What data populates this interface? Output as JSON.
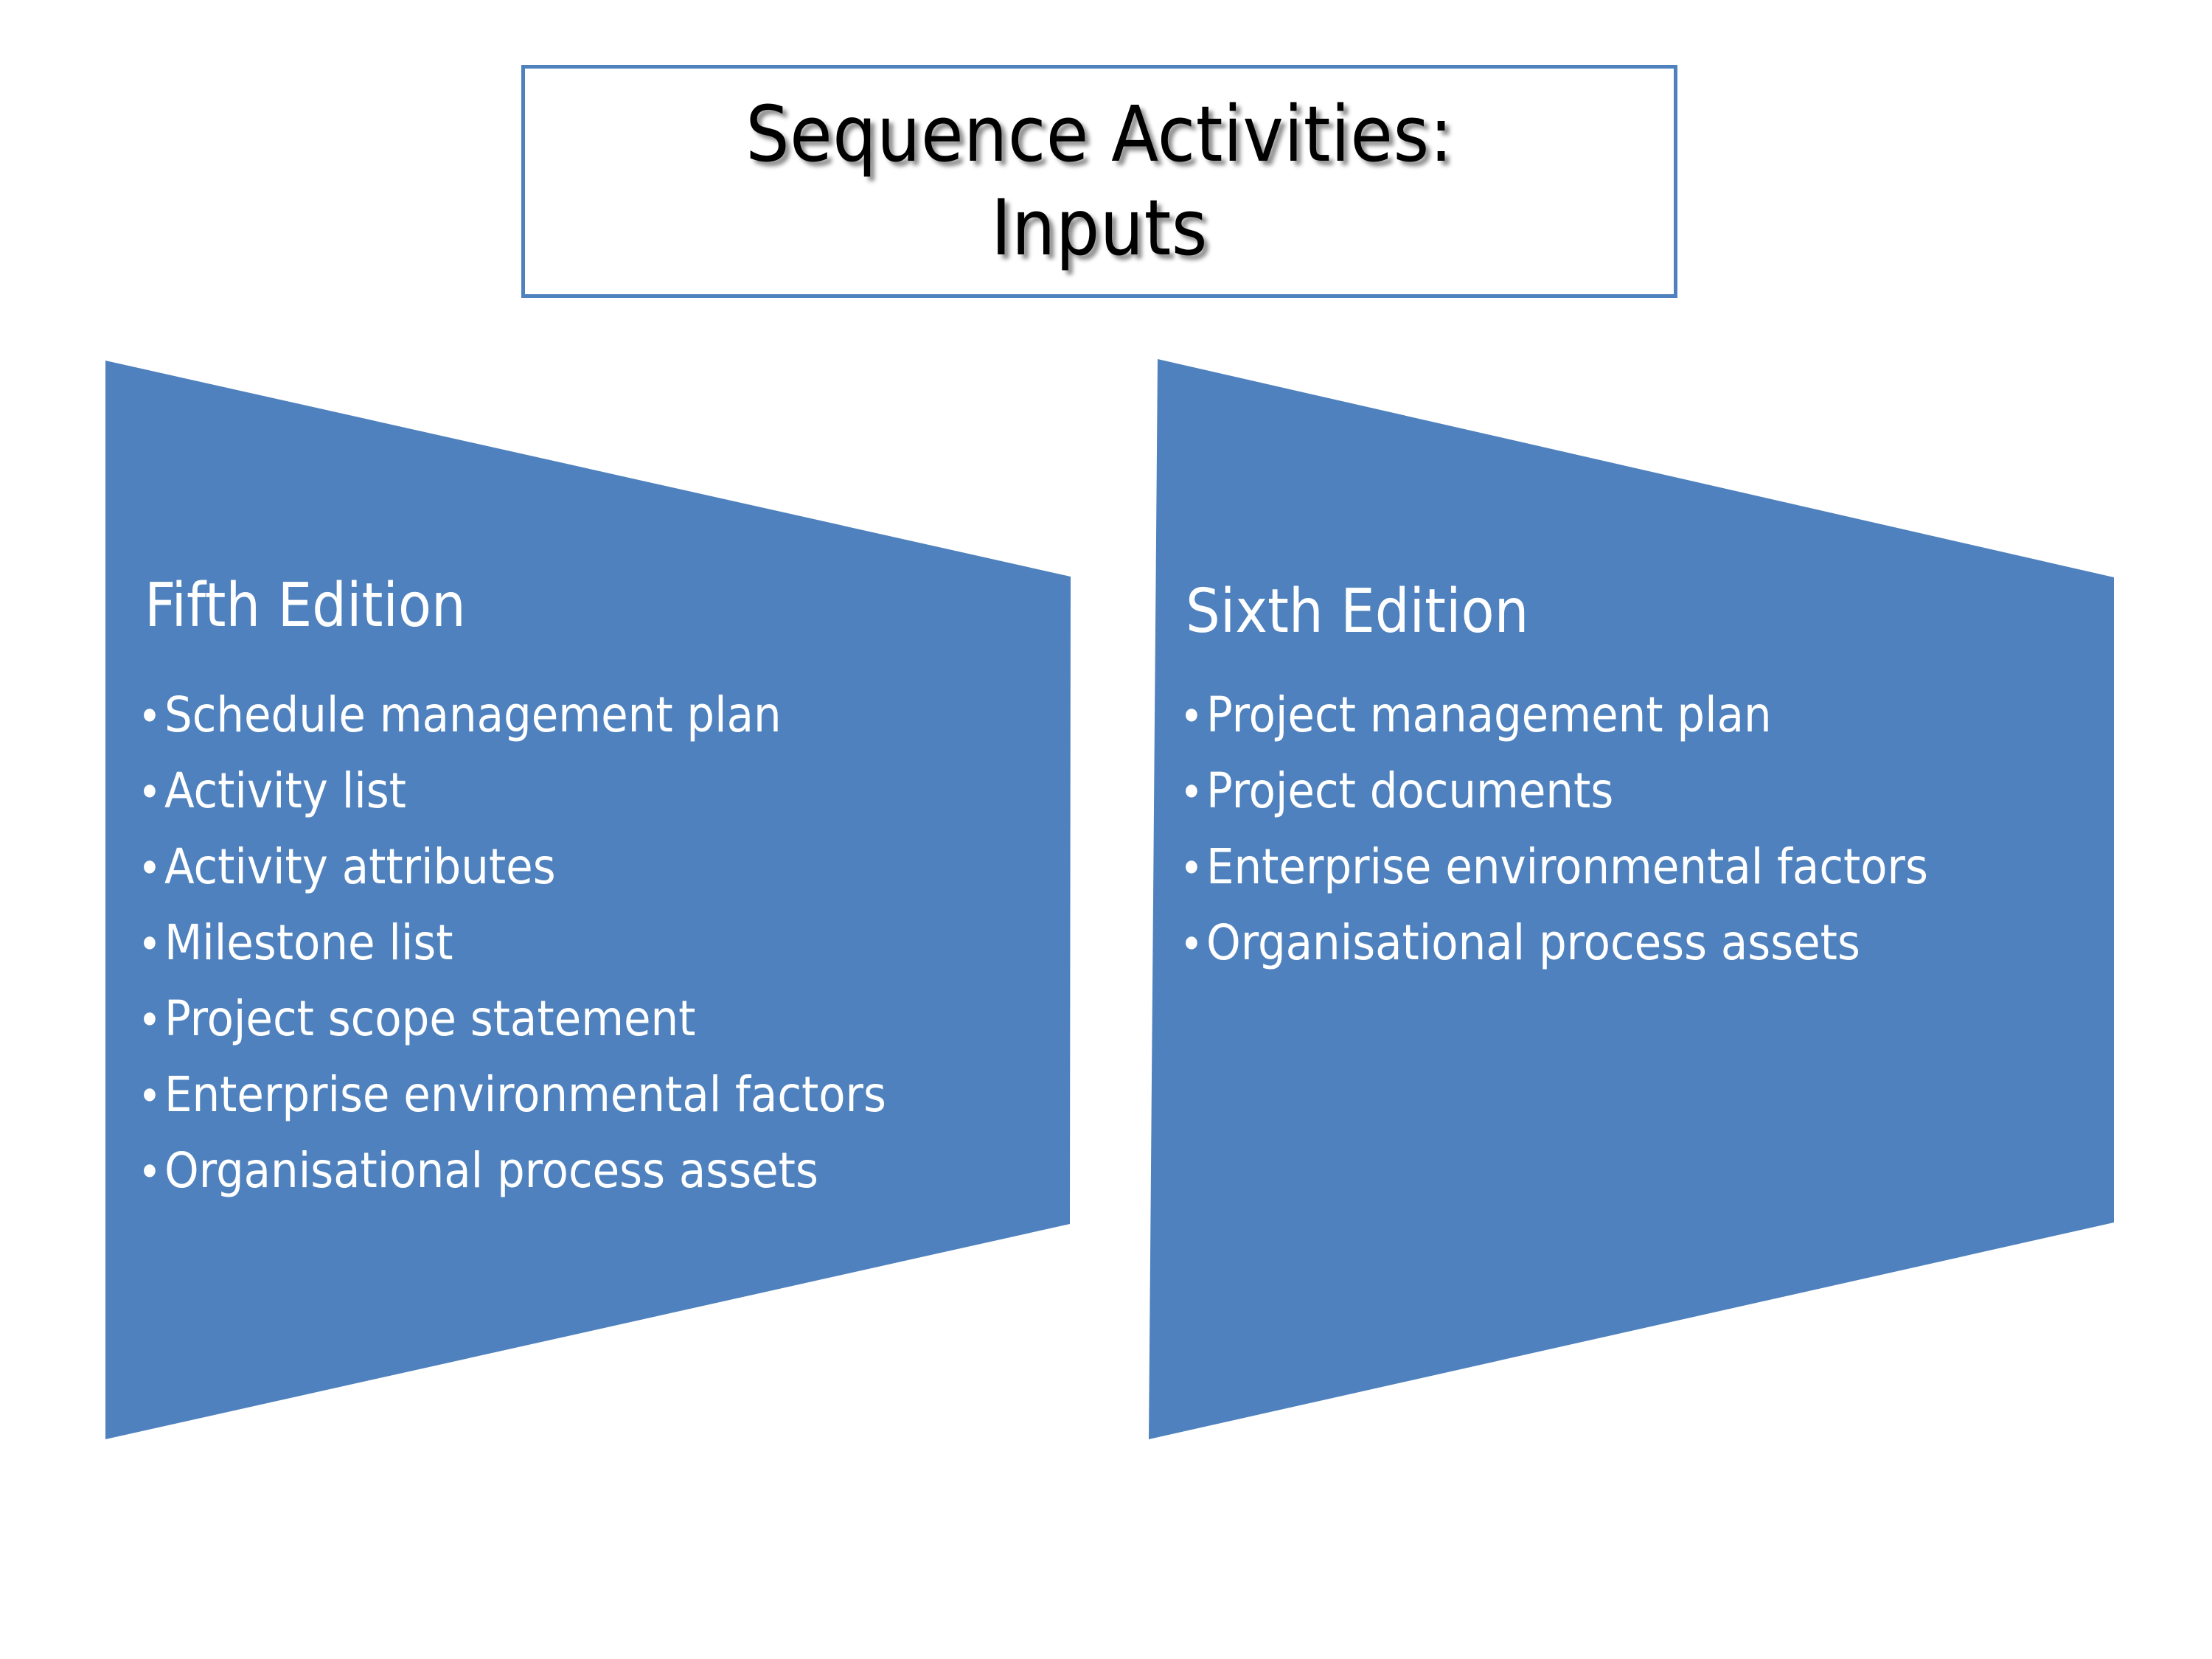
{
  "slide": {
    "background_color": "#FFFFFF",
    "accent_color": "#4E81BD",
    "text_on_accent_color": "#FFFFFF",
    "title_text_color": "#000000"
  },
  "title": {
    "line1": "Sequence Activities:",
    "line2": "Inputs"
  },
  "panels": [
    {
      "id": "fifth-edition",
      "heading": "Fifth Edition",
      "bullet_glyph": "•",
      "bullets": [
        "Schedule management plan",
        "Activity list",
        "Activity attributes",
        "Milestone list",
        "Project scope statement",
        "Enterprise environmental factors",
        "Organisational process assets"
      ]
    },
    {
      "id": "sixth-edition",
      "heading": "Sixth Edition",
      "bullet_glyph": "•",
      "bullets": [
        "Project management plan",
        "Project documents",
        "Enterprise environmental factors",
        "Organisational process assets"
      ]
    }
  ]
}
